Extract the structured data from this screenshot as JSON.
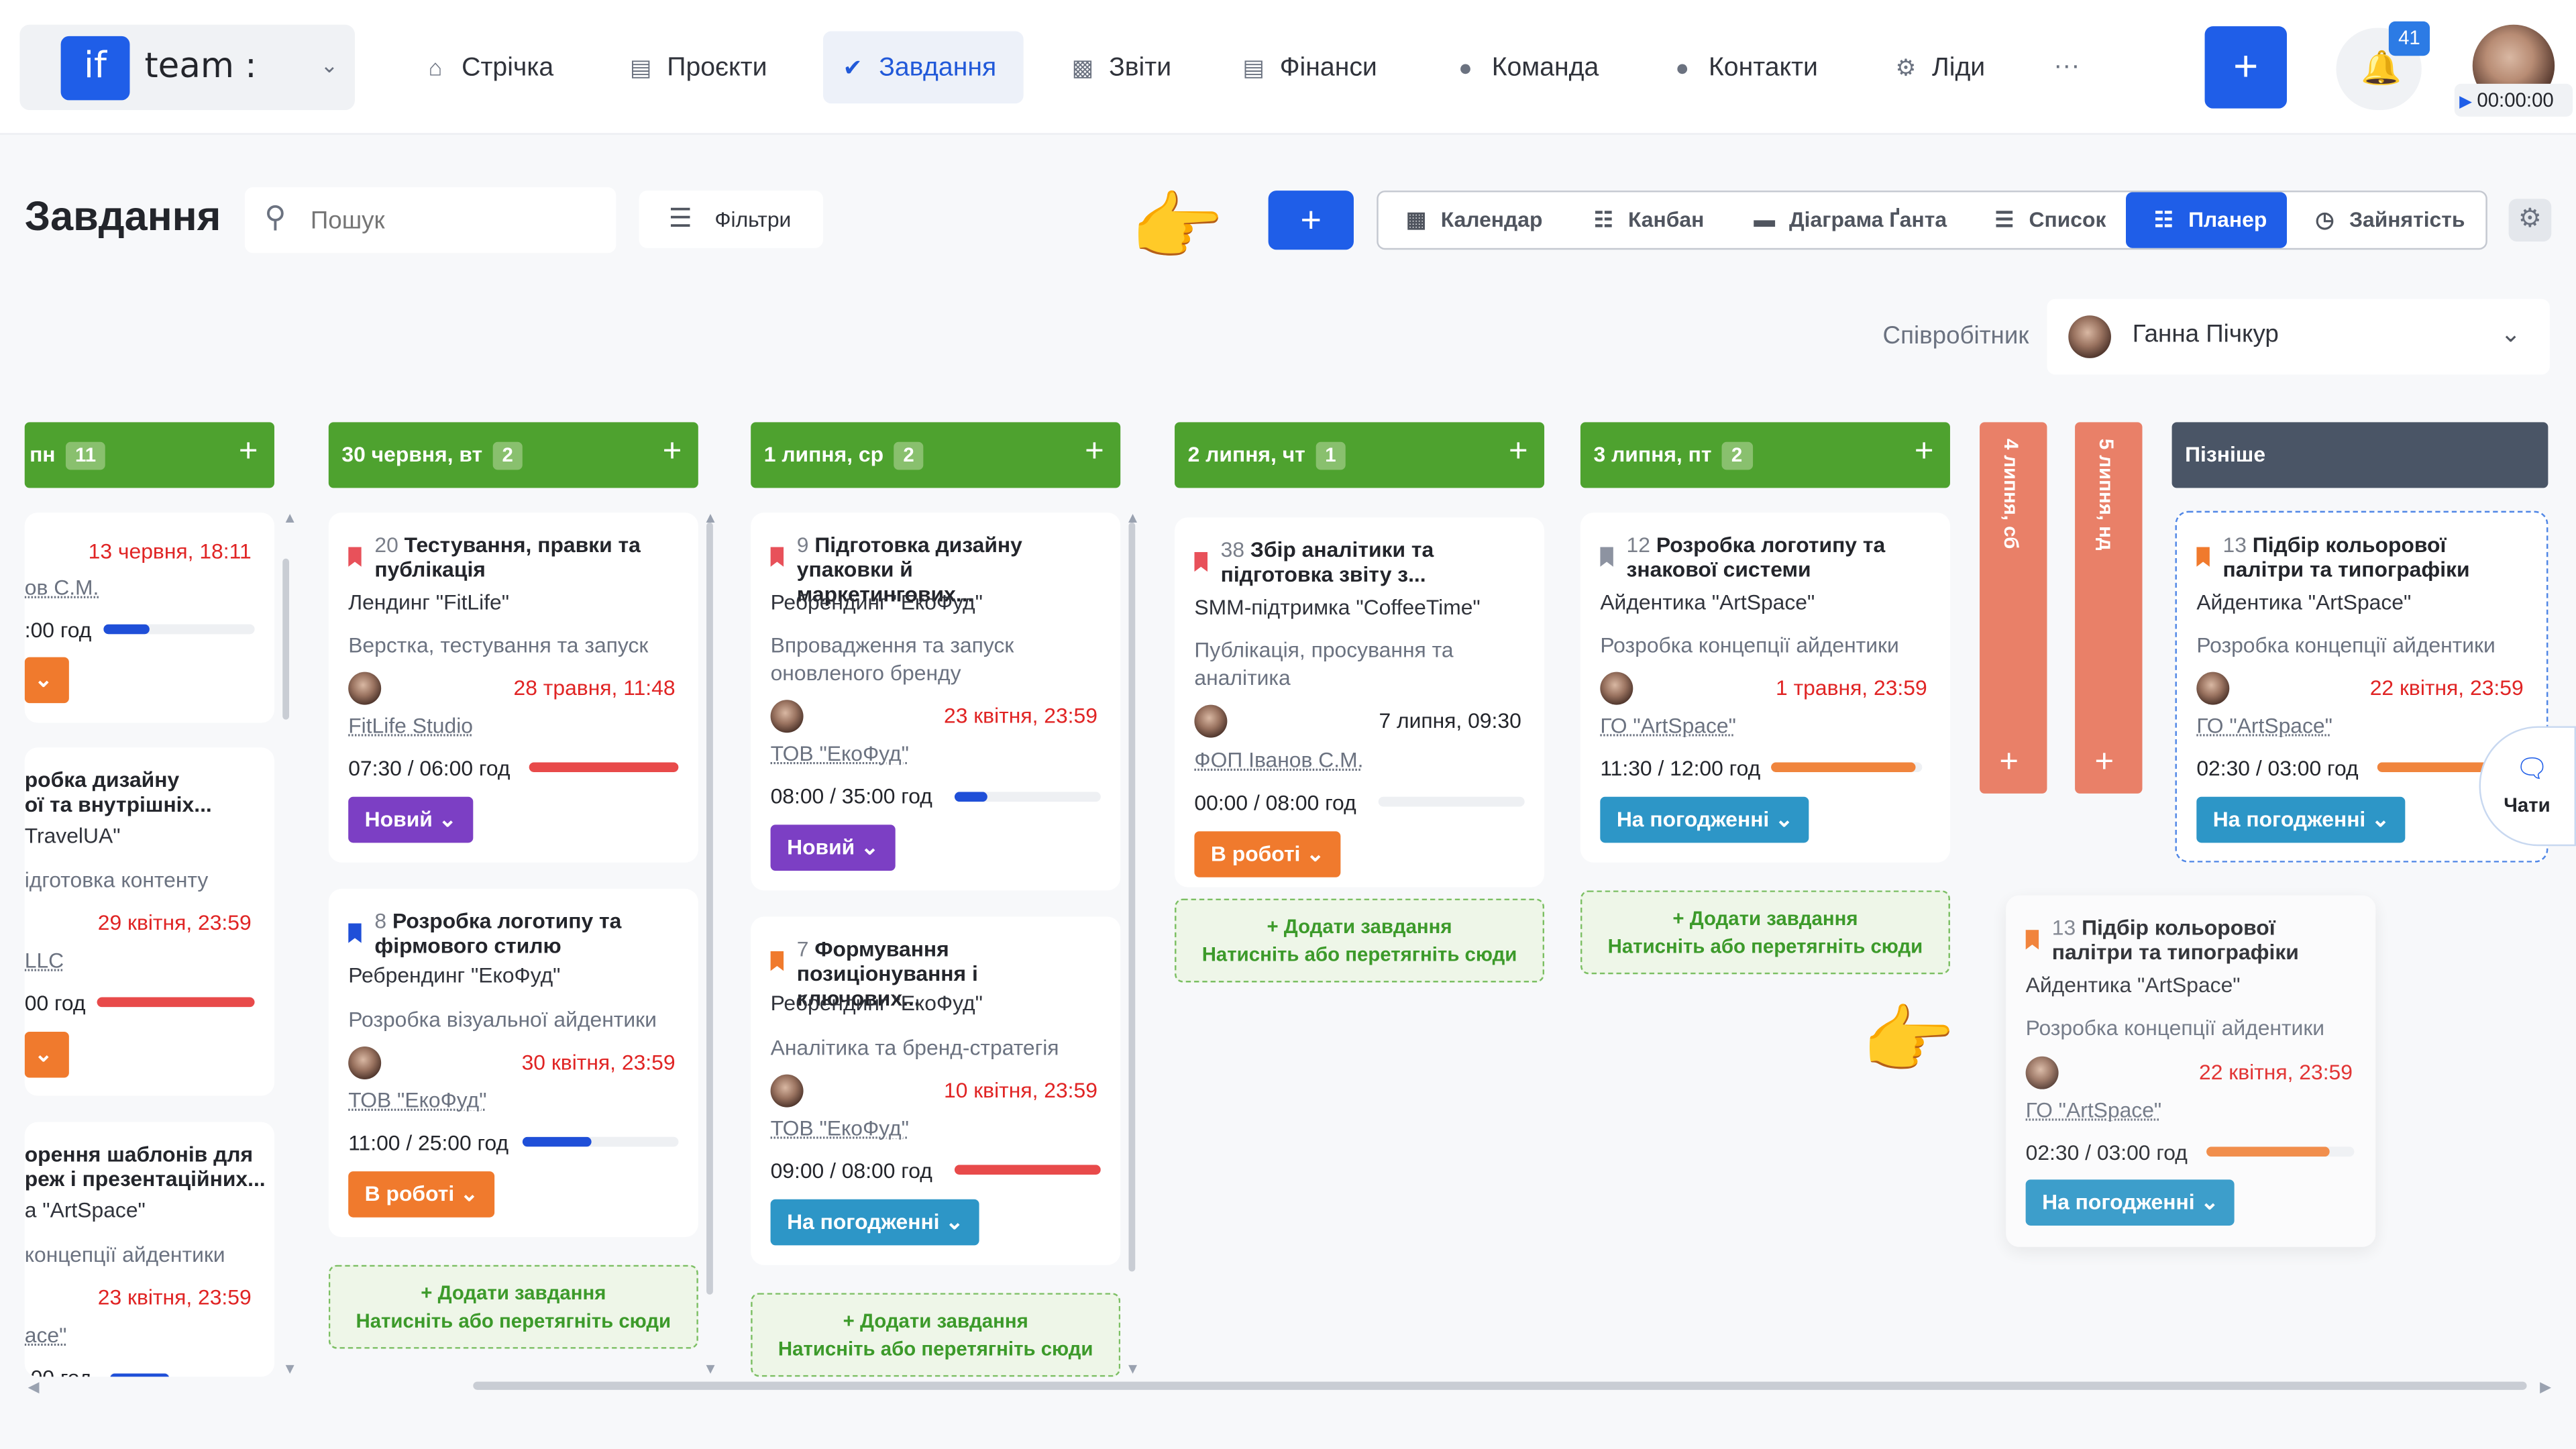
{
  "app": {
    "logo_mark": "if",
    "workspace": "team :"
  },
  "nav": {
    "items": [
      {
        "label": "Стрічка",
        "icon": "home-icon"
      },
      {
        "label": "Проєкти",
        "icon": "document-icon"
      },
      {
        "label": "Завдання",
        "icon": "check-circle-icon",
        "active": true
      },
      {
        "label": "Звіти",
        "icon": "report-icon"
      },
      {
        "label": "Фінанси",
        "icon": "wallet-icon"
      },
      {
        "label": "Команда",
        "icon": "person-icon"
      },
      {
        "label": "Контакти",
        "icon": "contacts-icon"
      },
      {
        "label": "Ліди",
        "icon": "leads-icon"
      }
    ],
    "more": "···",
    "notifications_count": "41",
    "timer": "00:00:00"
  },
  "page": {
    "title": "Завдання",
    "search_placeholder": "Пошук",
    "filter_label": "Фільтри",
    "add_label": "+",
    "views": [
      "Календар",
      "Канбан",
      "Діаграма Ґанта",
      "Список",
      "Планер",
      "Зайнятість"
    ],
    "active_view": "Планер",
    "employee_label": "Співробітник",
    "employee_name": "Ганна Пічкур"
  },
  "columns": [
    {
      "label": "пн",
      "count": "11"
    },
    {
      "label": "30 червня, вт",
      "count": "2"
    },
    {
      "label": "1 липня, ср",
      "count": "2"
    },
    {
      "label": "2 липня, чт",
      "count": "1"
    },
    {
      "label": "3 липня, пт",
      "count": "2"
    },
    {
      "label": "4 липня, сб"
    },
    {
      "label": "5 липня, нд"
    },
    {
      "label": "Пізніше"
    }
  ],
  "add_task": {
    "line1": "+ Додати завдання",
    "line2": "Натисніть або перетягніть сюди"
  },
  "cards": {
    "c0a": {
      "deadline": "13 червня, 18:11",
      "client": "ов С.М.",
      "hours": ":00 год",
      "progress": 0.3
    },
    "c0b": {
      "title": "робка дизайну",
      "title2": "ої та внутрішніх...",
      "project": "TravelUA\"",
      "stage": "ідготовка контенту",
      "deadline": "29 квітня, 23:59",
      "client": "LLC",
      "hours": "00 год",
      "progress": 1.0
    },
    "c0c": {
      "title": "орення шаблонів для",
      "title2": "реж і презентаційних...",
      "project": "а \"ArtSpace\"",
      "stage": "концепції айдентики",
      "deadline": "23 квітня, 23:59",
      "client": "ace\"",
      "hours": ":00 год"
    },
    "c1a": {
      "num": "20",
      "title": "Тестування, правки та публікація",
      "project": "Лендинг \"FitLife\"",
      "stage": "Верстка, тестування та запуск",
      "deadline": "28 травня, 11:48",
      "client": "FitLife Studio",
      "hours": "07:30 / 06:00 год",
      "progress": 1.0,
      "status": "Новий"
    },
    "c1b": {
      "num": "8",
      "title": "Розробка логотипу та фірмового стилю",
      "project": "Ребрендинг \"ЕкоФуд\"",
      "stage": "Розробка візуальної айдентики",
      "deadline": "30 квітня, 23:59",
      "client": "ТОВ \"ЕкоФуд\"",
      "hours": "11:00 / 25:00 год",
      "progress": 0.44,
      "status": "В роботі"
    },
    "c2a": {
      "num": "9",
      "title": "Підготовка дизайну упаковки й маркетингових...",
      "project": "Ребрендинг \"ЕкоФуд\"",
      "stage": "Впровадження та запуск оновленого бренду",
      "deadline": "23 квітня, 23:59",
      "client": "ТОВ \"ЕкоФуд\"",
      "hours": "08:00 / 35:00 год",
      "progress": 0.23,
      "status": "Новий"
    },
    "c2b": {
      "num": "7",
      "title": "Формування позиціонування і ключових...",
      "project": "Ребрендинг \"ЕкоФуд\"",
      "stage": "Аналітика та бренд-стратегія",
      "deadline": "10 квітня, 23:59",
      "client": "ТОВ \"ЕкоФуд\"",
      "hours": "09:00 / 08:00 год",
      "progress": 1.0,
      "status": "На погодженні"
    },
    "c3a": {
      "num": "38",
      "title": "Збір аналітики та підготовка звіту з...",
      "project": "SMM-підтримка \"CoffeeTime\"",
      "stage": "Публікація, просування та аналітика",
      "deadline": "7 липня, 09:30",
      "client": "ФОП Іванов С.М.",
      "hours": "00:00 / 08:00 год",
      "progress": 0.0,
      "status": "В роботі"
    },
    "c4a": {
      "num": "12",
      "title": "Розробка логотипу та знакової системи",
      "project": "Айдентика \"ArtSpace\"",
      "stage": "Розробка концепції айдентики",
      "deadline": "1 травня, 23:59",
      "client": "ГО \"ArtSpace\"",
      "hours": "11:30 / 12:00 год",
      "progress": 0.96,
      "status": "На погодженні"
    },
    "c7a": {
      "num": "13",
      "title": "Підбір кольорової палітри та типографіки",
      "project": "Айдентика \"ArtSpace\"",
      "stage": "Розробка концепції айдентики",
      "deadline": "22 квітня, 23:59",
      "client": "ГО \"ArtSpace\"",
      "hours": "02:30 / 03:00 год",
      "progress": 0.83,
      "status": "На погодженні"
    },
    "drag": {
      "num": "13",
      "title": "Підбір кольорової палітри та типографіки",
      "project": "Айдентика \"ArtSpace\"",
      "stage": "Розробка концепції айдентики",
      "deadline": "22 квітня, 23:59",
      "client": "ГО \"ArtSpace\"",
      "hours": "02:30 / 03:00 год",
      "progress": 0.83,
      "status": "На погодженні"
    }
  },
  "chats_label": "Чати",
  "colors": {
    "accent": "#1f5ee8",
    "col_green": "#4ea22f",
    "col_weekend": "#e98068",
    "col_late": "#4a5566",
    "status_new": "#7c3fc4",
    "status_work": "#f07a2d",
    "status_approval": "#2d96c7",
    "deadline_red": "#e02424"
  }
}
